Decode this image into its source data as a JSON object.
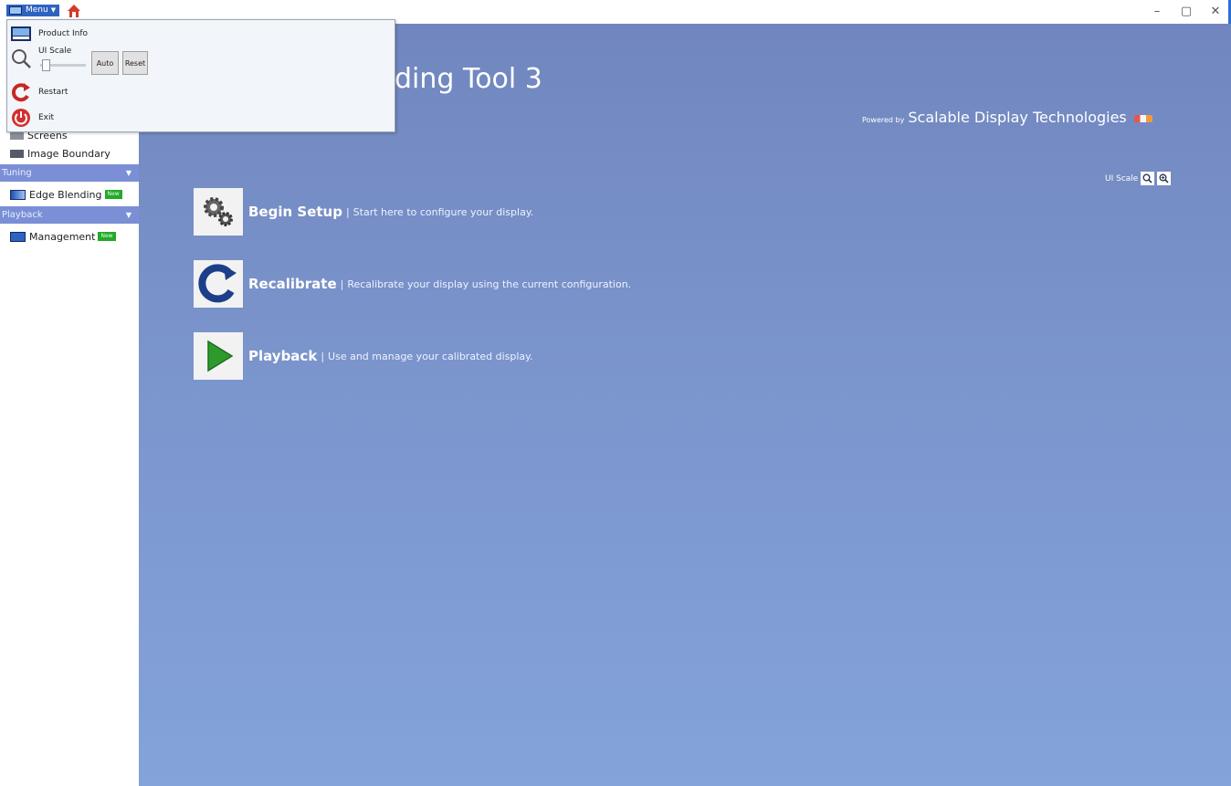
{
  "titlebar": {
    "menu_label": "Menu",
    "window_controls": {
      "minimize": "–",
      "restore": "▢",
      "close": "✕"
    }
  },
  "menu": {
    "product_info": "Product Info",
    "ui_scale": "UI Scale",
    "auto": "Auto",
    "reset": "Reset",
    "restart": "Restart",
    "exit": "Exit"
  },
  "sidebar": {
    "screens": "Screens",
    "image_boundary": "Image Boundary",
    "tuning_header": "Tuning",
    "edge_blending": "Edge Blending",
    "playback_header": "Playback",
    "management": "Management",
    "new_badge": "New"
  },
  "main": {
    "title": "ding Tool 3",
    "powered_by": "Powered by",
    "company": "Scalable Display Technologies",
    "ui_scale_label": "UI Scale",
    "actions": [
      {
        "name": "Begin Setup",
        "desc": "Start here to configure your display."
      },
      {
        "name": "Recalibrate",
        "desc": "Recalibrate your display using the current configuration."
      },
      {
        "name": "Playback",
        "desc": "Use and manage your calibrated display."
      }
    ],
    "separator": "|"
  },
  "colors": {
    "main_bg": "#7a93cb",
    "sidebar_header": "#7b8fd6",
    "menu_button": "#2f63c0",
    "new_badge": "#22aa2a"
  }
}
